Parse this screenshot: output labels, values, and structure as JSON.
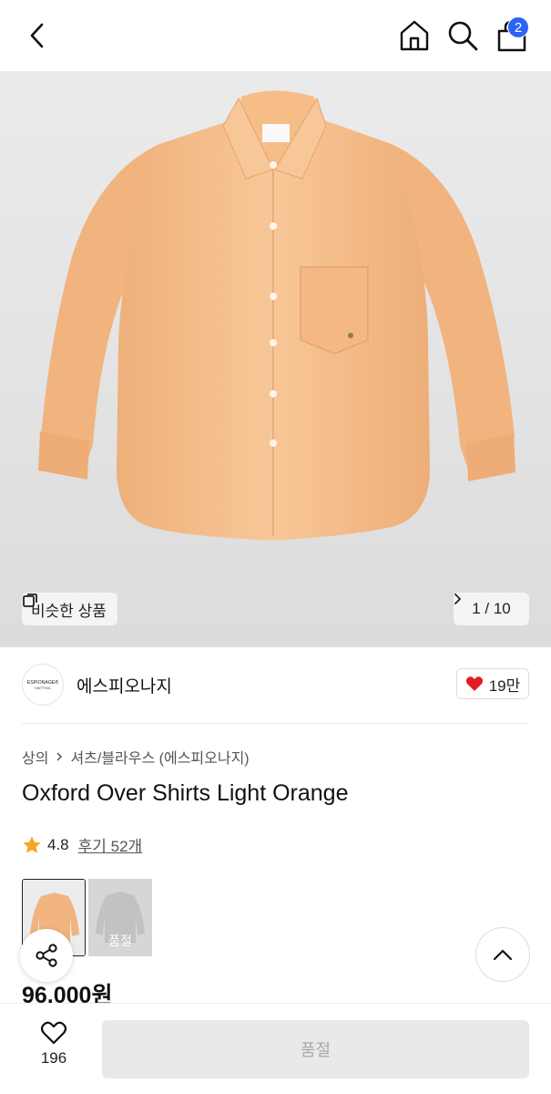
{
  "header": {
    "back_icon": "chevron-left-icon",
    "home_icon": "home-icon",
    "search_icon": "search-icon",
    "cart_icon": "shopping-bag-icon",
    "cart_count": "2",
    "badge_color": "#2a64f6"
  },
  "hero": {
    "similar_label": "비슷한 상품",
    "pager": "1 / 10",
    "product_color": "#f6c08d"
  },
  "brand": {
    "logo_text": "ESPIONAGE®\nKNITTING",
    "name": "에스피오나지",
    "likes": "19만"
  },
  "product": {
    "breadcrumb": [
      "상의",
      "셔츠/블라우스 (에스피오나지)"
    ],
    "title": "Oxford Over Shirts Light Orange",
    "rating": "4.8",
    "reviews": "후기 52개",
    "swatches": [
      {
        "name": "Light Orange",
        "selected": true
      },
      {
        "name": "Grey",
        "sold_out_label": "품절"
      }
    ],
    "price": "96,000원"
  },
  "bottom": {
    "wish_count": "196",
    "buy_label": "품절"
  }
}
